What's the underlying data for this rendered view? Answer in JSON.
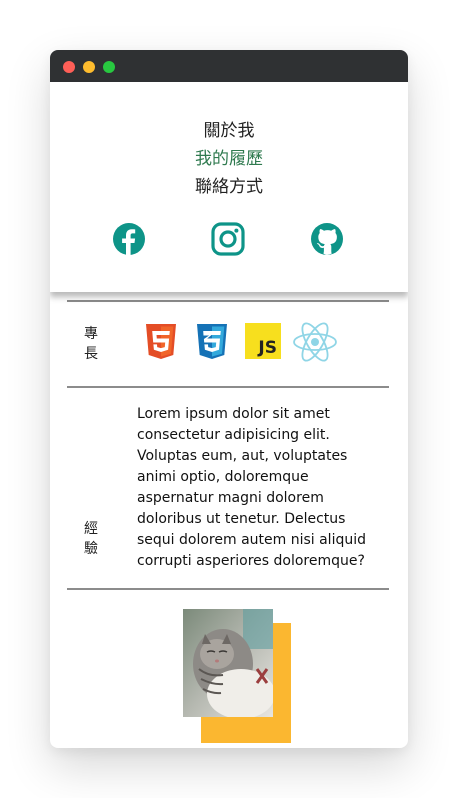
{
  "nav": {
    "items": [
      {
        "label": "關於我",
        "active": false
      },
      {
        "label": "我的履歷",
        "active": true
      },
      {
        "label": "聯絡方式",
        "active": false
      }
    ],
    "active_color": "#2f7a4f"
  },
  "social": [
    "facebook-icon",
    "instagram-icon",
    "github-icon"
  ],
  "social_color": "#0e9488",
  "skills": {
    "label": "專長",
    "items": [
      "html5-icon",
      "css3-icon",
      "javascript-icon",
      "react-icon"
    ],
    "js_text": "JS"
  },
  "experience": {
    "label": "經驗",
    "text": "Lorem ipsum dolor sit amet consectetur adipisicing elit. Voluptas eum, aut, voluptates animi optio, doloremque aspernatur magni dolorem doloribus ut tenetur. Delectus sequi dolorem autem nisi aliquid corrupti asperiores doloremque?"
  },
  "accent": "#fbb730"
}
